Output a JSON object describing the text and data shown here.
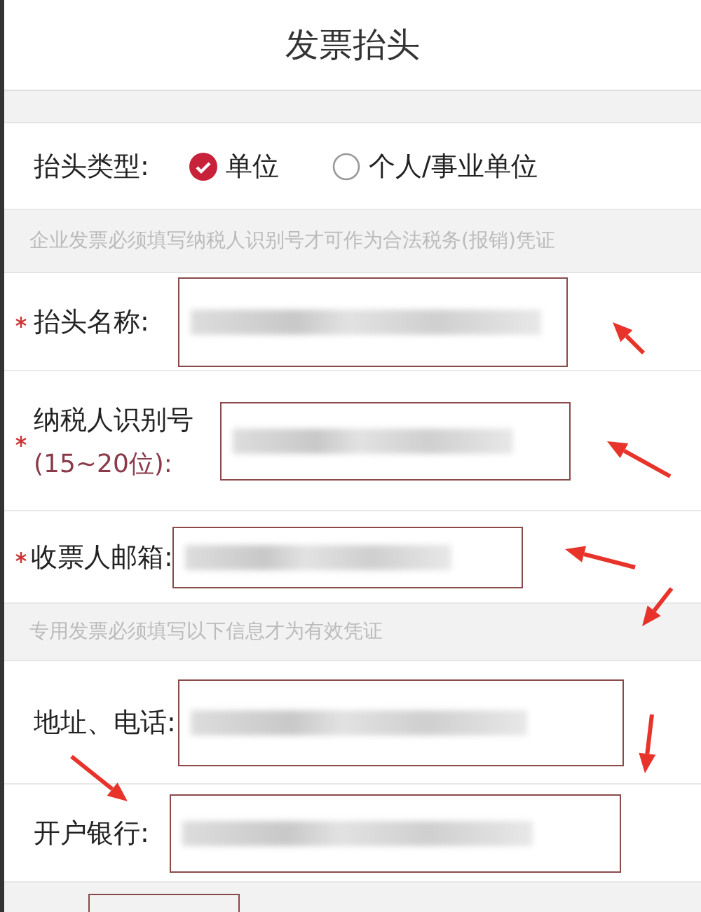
{
  "title": "发票抬头",
  "header_type": {
    "label": "抬头类型:",
    "options": [
      {
        "label": "单位",
        "selected": true
      },
      {
        "label": "个人/事业单位",
        "selected": false
      }
    ]
  },
  "sections": [
    {
      "hint": "企业发票必须填写纳税人识别号才可作为合法税务(报销)凭证",
      "fields": [
        {
          "label": "抬头名称:",
          "required": true
        },
        {
          "label": "纳税人识别号",
          "sublabel": "(15~20位):",
          "required": true
        },
        {
          "label": "收票人邮箱:",
          "required": true
        }
      ]
    },
    {
      "hint": "专用发票必须填写以下信息才为有效凭证",
      "fields": [
        {
          "label": "地址、电话:",
          "required": false
        },
        {
          "label": "开户银行:",
          "required": false
        }
      ]
    }
  ]
}
